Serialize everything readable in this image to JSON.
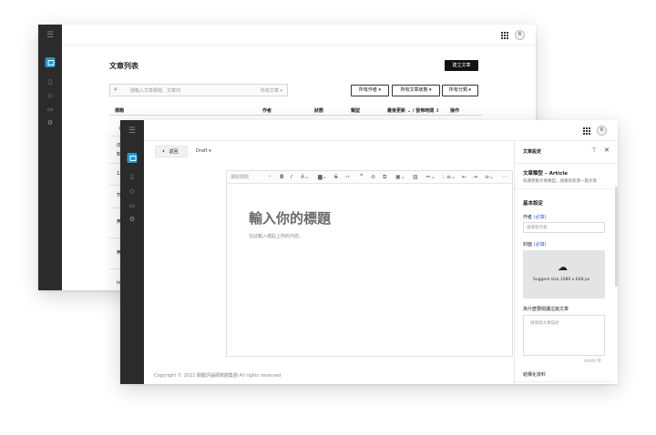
{
  "back_window": {
    "page_title": "文章列表",
    "create_button": "建立文章",
    "search_placeholder": "請輸入文章標題、文章ID",
    "search_scope": "所有文章",
    "filters": [
      "所有作者",
      "所有文章狀態",
      "所有分類"
    ],
    "columns": [
      "標題",
      "作者",
      "狀態",
      "類型",
      "最後更新",
      "/ 發佈時間",
      "操作"
    ],
    "row_stubs": [
      "《",
      "(E",
      "知",
      "12",
      "Th",
      "無",
      "無",
      "im"
    ],
    "avatar_letter": "R"
  },
  "front_window": {
    "back_label": "返回",
    "status_select": "Draft",
    "toolbar_style_select": "選取標題",
    "title_placeholder": "輸入你的標題",
    "body_placeholder": "在此輸入或貼上你的內容。",
    "footer": "Copyright © 2022 關鍵評論網媒體集團 All rights reserved",
    "avatar_letter": "R",
    "panel": {
      "title": "文章設定",
      "type_heading": "文章類型 – Article",
      "type_desc": "知識更動文章類型，請重新新增一篇文章",
      "basic_settings": "基本設定",
      "author_label": "作者",
      "required_tag": "(必填)",
      "author_placeholder": "請填寫作者",
      "cover_label": "封面",
      "cover_hint": "Suggest size 1080 x 648 px",
      "why_label": "為什麼要閱讀這篇文章",
      "why_placeholder": "請填寫文章描述",
      "counter": "0/400 字",
      "structured_label": "結構化資料"
    }
  },
  "icons": [
    "menu-icon",
    "logo-icon",
    "document-icon",
    "layers-icon",
    "folder-icon",
    "settings-icon",
    "apps-grid-icon",
    "search-icon",
    "chevron-left-icon",
    "caret-down-icon",
    "pin-icon",
    "close-icon",
    "upload-cloud-icon"
  ],
  "colors": {
    "rail": "#2b2b2b",
    "accent_blue": "#1a9ad6",
    "link_blue": "#3b5bdb",
    "primary_button": "#111111"
  }
}
